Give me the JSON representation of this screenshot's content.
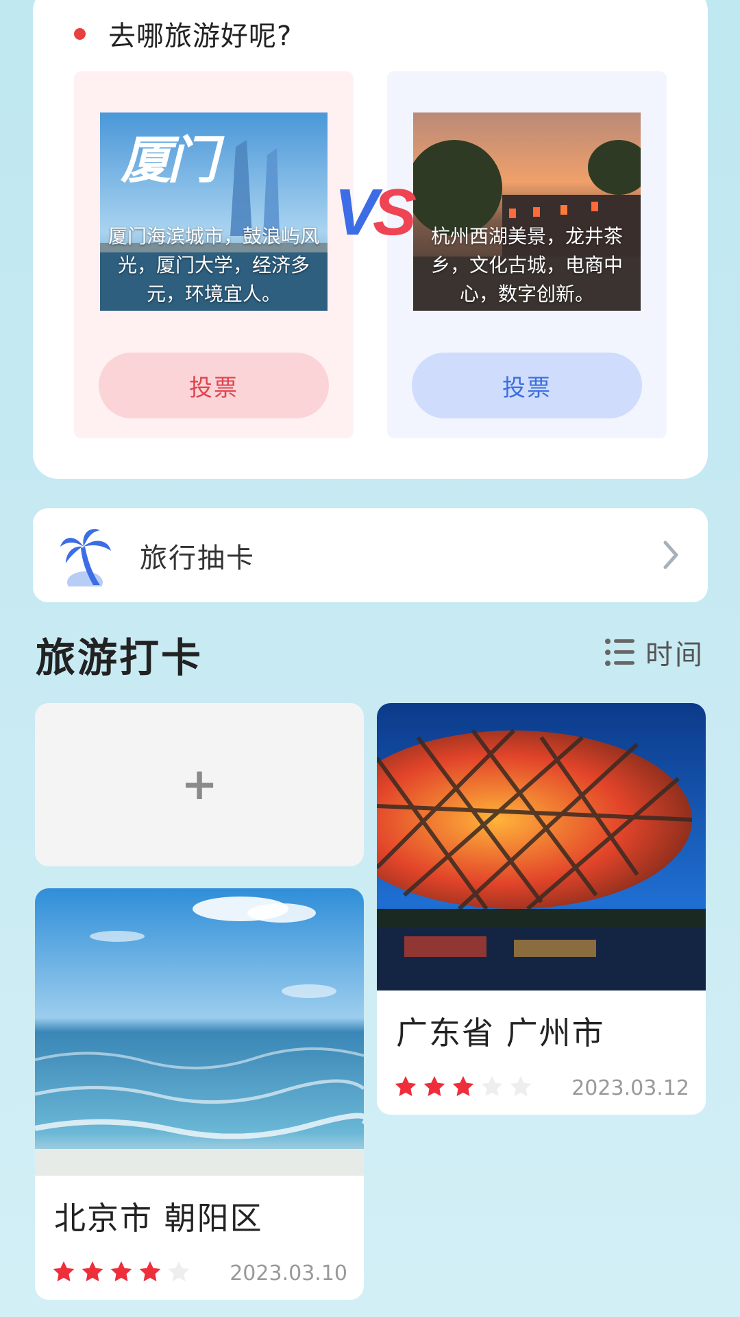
{
  "vote": {
    "title": "去哪旅游好呢?",
    "left": {
      "image_text": "厦门",
      "description": "厦门海滨城市，鼓浪屿风光，厦门大学，经济多元，环境宜人。",
      "button_label": "投票"
    },
    "right": {
      "description": "杭州西湖美景，龙井茶乡，文化古城，电商中心，数字创新。",
      "button_label": "投票"
    },
    "vs_v": "V",
    "vs_s": "S"
  },
  "draw_card": {
    "label": "旅行抽卡",
    "icon": "palm-tree-icon"
  },
  "section": {
    "title": "旅游打卡",
    "sort_label": "时间",
    "sort_icon": "list-icon"
  },
  "add_card": {
    "symbol": "+"
  },
  "cards": [
    {
      "place": "广东省 广州市",
      "rating": 3,
      "max_rating": 5,
      "date": "2023.03.12"
    },
    {
      "place": "北京市 朝阳区",
      "rating": 4,
      "max_rating": 5,
      "date": "2023.03.10"
    }
  ],
  "colors": {
    "accent_red": "#e8403e",
    "accent_blue": "#3c6de6",
    "star_on": "#ee2e3b",
    "star_off": "#eeeeee"
  }
}
